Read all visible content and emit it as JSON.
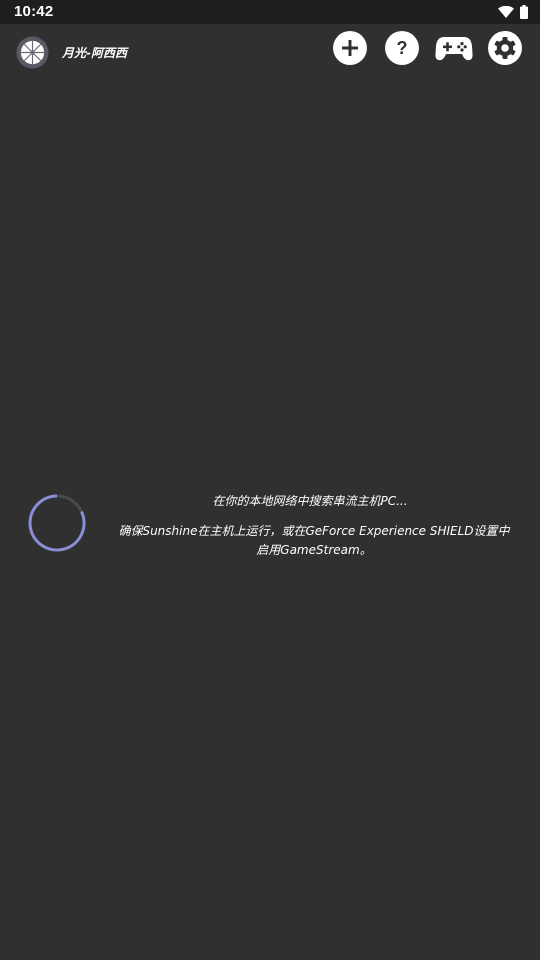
{
  "status_bar": {
    "time": "10:42",
    "icons": [
      "wifi-icon",
      "battery-icon"
    ]
  },
  "app_bar": {
    "title": "月光-阿西西",
    "logo_icon": "moonlight-logo-icon",
    "actions": [
      {
        "name": "add-pc-button",
        "icon": "plus-icon"
      },
      {
        "name": "help-button",
        "icon": "question-icon"
      },
      {
        "name": "gamepad-button",
        "icon": "gamepad-icon"
      },
      {
        "name": "settings-button",
        "icon": "gear-icon"
      }
    ]
  },
  "main": {
    "searching_text": "在你的本地网络中搜索串流主机PC...",
    "help_text": "确保Sunshine在主机上运行，或在GeForce Experience SHIELD设置中启用GameStream。"
  },
  "colors": {
    "background": "#303030",
    "status_bar": "#1f1f1f",
    "spinner": "#8a8ed6",
    "icon_bg": "#ffffff"
  }
}
